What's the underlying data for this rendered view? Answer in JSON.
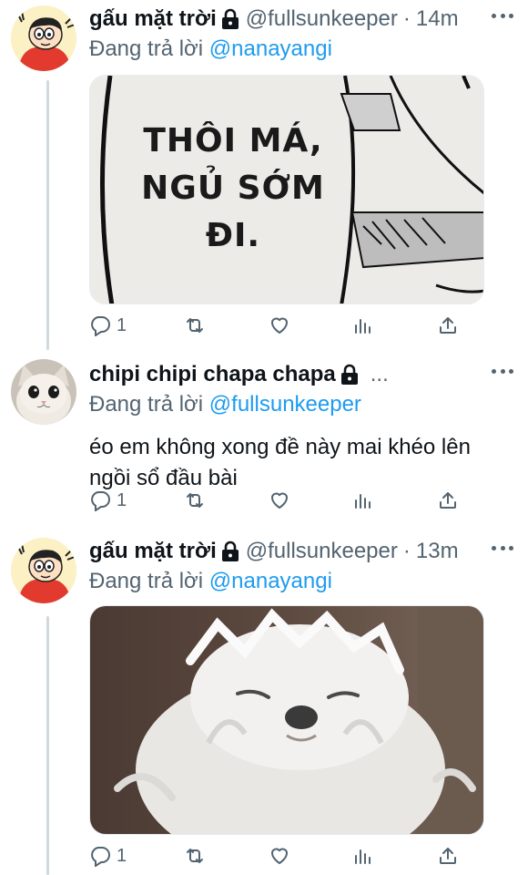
{
  "colors": {
    "accent": "#1d9bf0",
    "text": "#0f1419",
    "secondary": "#536471",
    "thread_line": "#cfd9de"
  },
  "tweets": [
    {
      "display_name": "gấu mặt trời",
      "handle": "@fullsunkeeper",
      "separator": "·",
      "time": "14m",
      "reply_prefix": "Đang trả lời",
      "reply_to": "@nanayangi",
      "media": {
        "caption_lines": [
          "THÔI MÁ,",
          "NGỦ SỚM",
          "ĐI."
        ]
      },
      "actions": {
        "reply_count": "1"
      }
    },
    {
      "display_name": "chipi chipi chapa chapa",
      "truncated": "...",
      "reply_prefix": "Đang trả lời",
      "reply_to": "@fullsunkeeper",
      "text": "éo em không xong đề này mai khéo lên ngồi sổ đầu bài",
      "actions": {
        "reply_count": "1"
      }
    },
    {
      "display_name": "gấu mặt trời",
      "handle": "@fullsunkeeper",
      "separator": "·",
      "time": "13m",
      "reply_prefix": "Đang trả lời",
      "reply_to": "@nanayangi",
      "actions": {
        "reply_count": "1"
      }
    }
  ]
}
